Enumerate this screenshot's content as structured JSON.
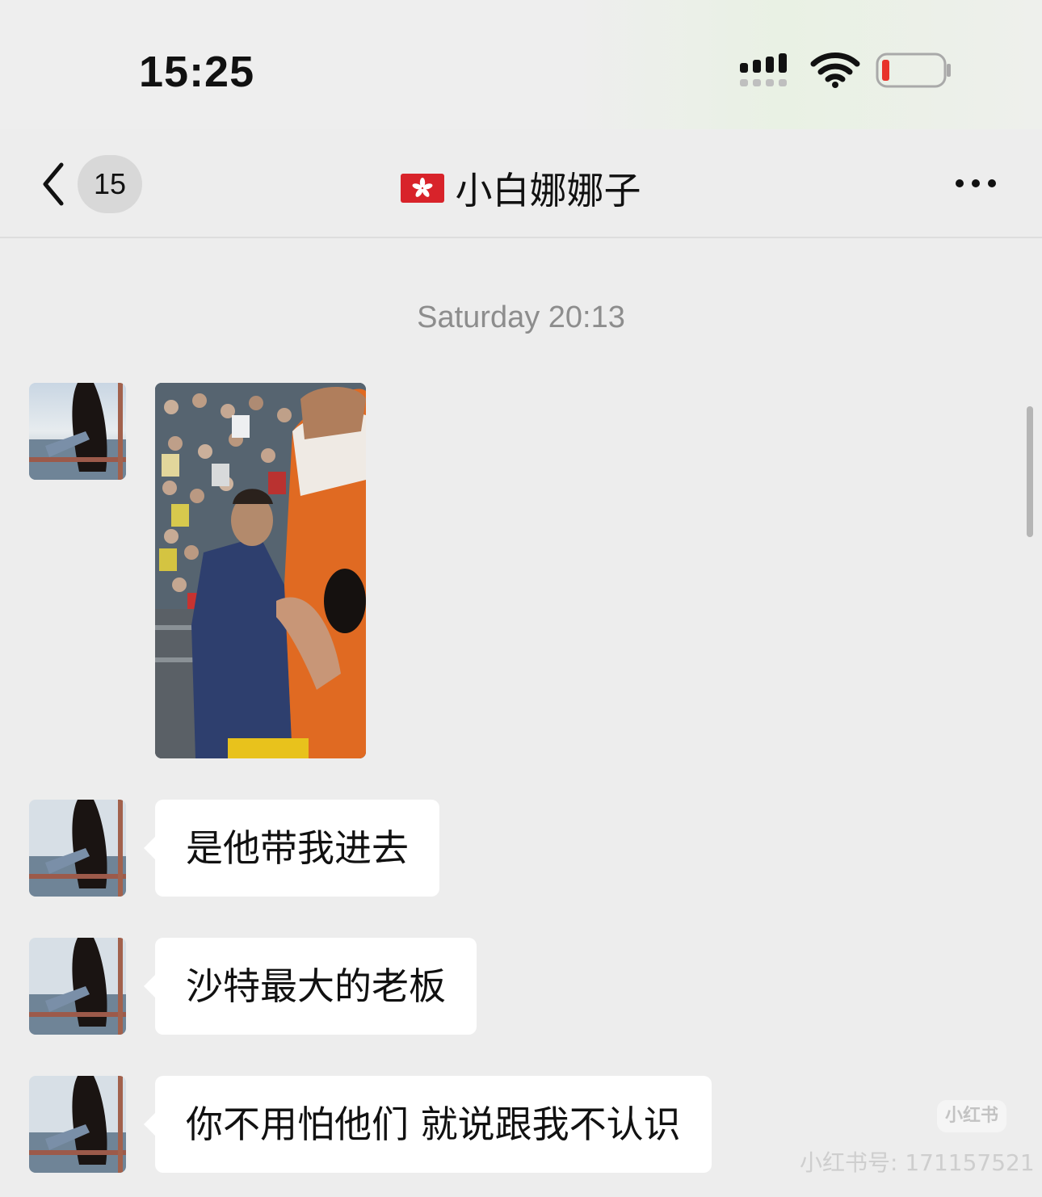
{
  "status_bar": {
    "time": "15:25",
    "signal_icon": "cellular-signal-icon",
    "wifi_icon": "wifi-icon",
    "battery_icon": "battery-low-icon",
    "battery_color": "#e8332a"
  },
  "nav": {
    "back_icon": "chevron-left-icon",
    "unread_count": "15",
    "flag_icon": "hong-kong-flag-icon",
    "title": "小白娜娜子",
    "more_icon": "more-dots-icon"
  },
  "chat": {
    "timestamp": "Saturday 20:13",
    "messages": [
      {
        "type": "image",
        "sender": "contact",
        "image_desc": "stadium-photo"
      },
      {
        "type": "text",
        "sender": "contact",
        "text": "是他带我进去"
      },
      {
        "type": "text",
        "sender": "contact",
        "text": "沙特最大的老板"
      },
      {
        "type": "text",
        "sender": "contact",
        "text": "你不用怕他们 就说跟我不认识"
      }
    ]
  },
  "watermark": {
    "logo": "小红书",
    "text": "小红书号: 171157521"
  }
}
